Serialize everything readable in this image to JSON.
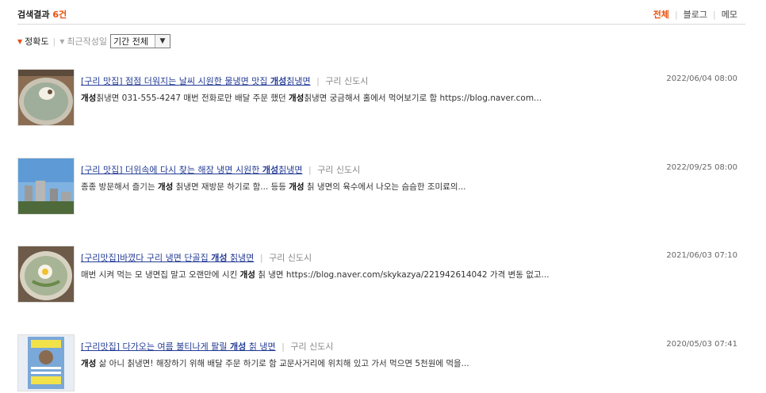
{
  "header": {
    "title_label": "검색결과",
    "count": "6건",
    "tabs": [
      "전체",
      "블로그",
      "메모"
    ],
    "active_tab": "전체"
  },
  "sort": {
    "accuracy_label": "정확도",
    "recent_label": "최근작성일",
    "period_value": "기간 전체"
  },
  "results": [
    {
      "title_pre": "[구리 맛집] 점점 더워지는 날씨 시원한 물냉면 맛집 ",
      "title_bold": "개성",
      "title_post": "칡냉면",
      "blog": "구리 신도시",
      "date": "2022/06/04 08:00",
      "snippet_parts": [
        {
          "b": true,
          "t": "개성"
        },
        {
          "b": false,
          "t": "칡냉면 031-555-4247 매번 전화로만 배달 주문 했던 "
        },
        {
          "b": true,
          "t": "개성"
        },
        {
          "b": false,
          "t": "칡냉면 궁금해서 홀에서 먹어보기로 함 https://blog.naver.com..."
        }
      ]
    },
    {
      "title_pre": "[구리 맛집] 더위속에 다시 찾는 해장 냉면 시원한 ",
      "title_bold": "개성",
      "title_post": "칡냉면",
      "blog": "구리 신도시",
      "date": "2022/09/25 08:00",
      "snippet_parts": [
        {
          "b": false,
          "t": "종종 방문해서 즐기는 "
        },
        {
          "b": true,
          "t": "개성"
        },
        {
          "b": false,
          "t": " 칡냉면 재방문 하기로 함... 등등 "
        },
        {
          "b": true,
          "t": "개성"
        },
        {
          "b": false,
          "t": " 칡 냉면의 육수에서 나오는 슴슴한 조미료의..."
        }
      ]
    },
    {
      "title_pre": "[구리맛집]바꼈다 구리 냉면 단골집 ",
      "title_bold": "개성",
      "title_post": " 칡냉면",
      "blog": "구리 신도시",
      "date": "2021/06/03 07:10",
      "snippet_parts": [
        {
          "b": false,
          "t": "매번 시켜 먹는 모 냉면집 말고 오랜만에 시킨 "
        },
        {
          "b": true,
          "t": "개성"
        },
        {
          "b": false,
          "t": " 칡 냉면 https://blog.naver.com/skykazya/221942614042 가격 변동 없고..."
        }
      ]
    },
    {
      "title_pre": "[구리맛집] 다가오는 여름 불티나게 팔릴 ",
      "title_bold": "개성",
      "title_post": " 칡 냉면",
      "blog": "구리 신도시",
      "date": "2020/05/03 07:41",
      "snippet_parts": [
        {
          "b": true,
          "t": "개성"
        },
        {
          "b": false,
          "t": " 삶 아니 칡냉면! 해장하기 위해 배달 주문 하기로 함 교문사거리에 위치해 있고 가서 먹으면 5천원에 먹을..."
        }
      ]
    }
  ]
}
